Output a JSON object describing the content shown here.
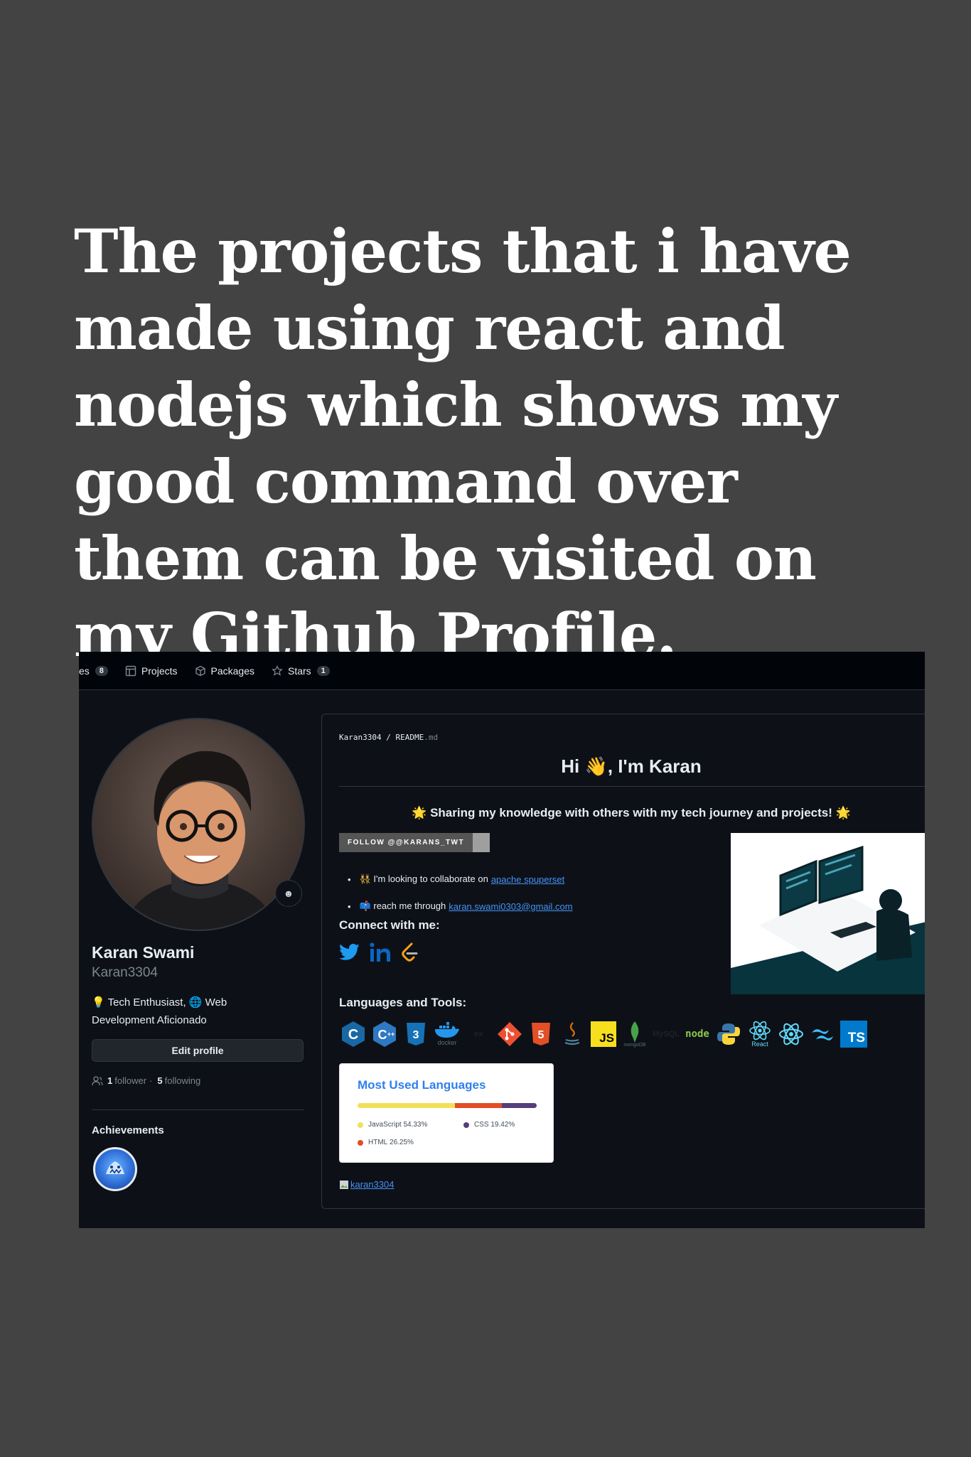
{
  "headline": "The projects that i have made using react and nodejs which shows my good command over them can be visited on my Github Profile.",
  "nav": {
    "repos_partial": "es",
    "repos_count": "8",
    "projects": "Projects",
    "packages": "Packages",
    "stars": "Stars",
    "stars_count": "1"
  },
  "profile": {
    "name": "Karan Swami",
    "login": "Karan3304",
    "bio": "💡 Tech Enthusiast, 🌐 Web Development Aficionado",
    "edit_label": "Edit profile",
    "followers_count": "1",
    "followers_label": "follower",
    "separator": "·",
    "following_count": "5",
    "following_label": "following",
    "achievements_title": "Achievements"
  },
  "readme": {
    "crumb_user": "Karan3304",
    "crumb_sep": " / ",
    "crumb_file": "README",
    "crumb_ext": ".md",
    "heading": "Hi 👋, I'm Karan",
    "tagline": "🌟 Sharing my knowledge with others with my tech journey and projects! 🌟",
    "twitter_badge": "FOLLOW @@KARANS_TWT",
    "collab_text": "👯 I'm looking to collaborate on",
    "collab_link": "apache spuperset",
    "reach_text": "📫 reach me through",
    "reach_link": "karan.swami0303@gmail.com",
    "connect_title": "Connect with me:",
    "languages_title": "Languages and Tools:",
    "tool_labels": {
      "docker": "docker",
      "react": "React",
      "js": "JS",
      "ts": "TS",
      "mongodb": "mongoDB"
    },
    "footer_link": "karan3304"
  },
  "languages_card": {
    "title": "Most Used Languages",
    "items": [
      {
        "name": "JavaScript",
        "percent": "54.33%",
        "value": 54.33,
        "color": "#f1e05a"
      },
      {
        "name": "HTML",
        "percent": "26.25%",
        "value": 26.25,
        "color": "#e34c26"
      },
      {
        "name": "CSS",
        "percent": "19.42%",
        "value": 19.42,
        "color": "#563d7c"
      }
    ]
  },
  "colors": {
    "link": "#4493f8",
    "bg": "#0d1117",
    "page": "#434343"
  }
}
